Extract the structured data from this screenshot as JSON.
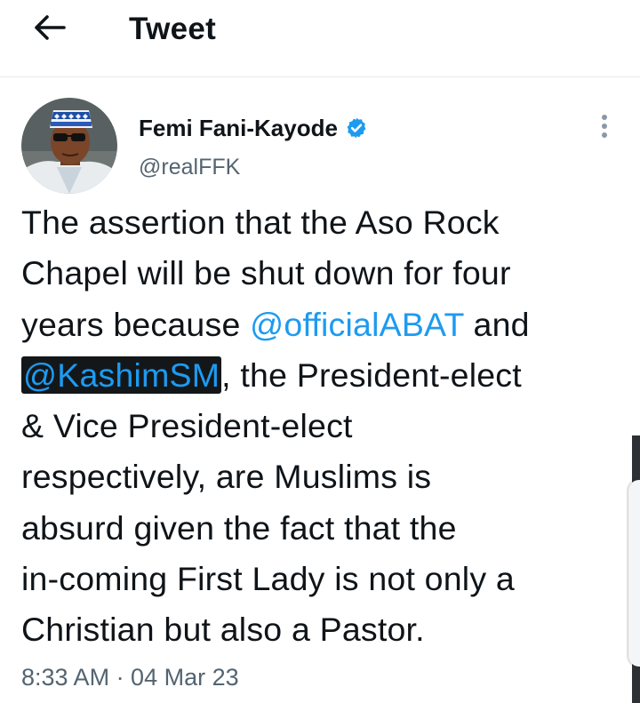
{
  "header": {
    "title": "Tweet"
  },
  "author": {
    "name": "Femi Fani-Kayode",
    "handle": "@realFFK"
  },
  "tweet": {
    "line1": "The assertion that the Aso Rock",
    "line2": "Chapel will be shut down for four",
    "line3a": "years because ",
    "mention1": "@officialABAT",
    "line3b": " and",
    "mention2": "@KashimSM",
    "line4b": ", the President-elect",
    "line5": "& Vice President-elect",
    "line6": "respectively, are Muslims is",
    "line7": "absurd given the fact that the",
    "line8": "in-coming First Lady is not only a",
    "line9": "Christian but also a Pastor.",
    "timestamp": "8:33 AM · 04 Mar 23"
  },
  "colors": {
    "accent": "#1d9bf0",
    "text": "#0f1419",
    "secondary": "#536471"
  },
  "icons": {
    "back": "arrow-left-icon",
    "verified": "verified-badge-icon",
    "more": "more-vertical-icon"
  }
}
